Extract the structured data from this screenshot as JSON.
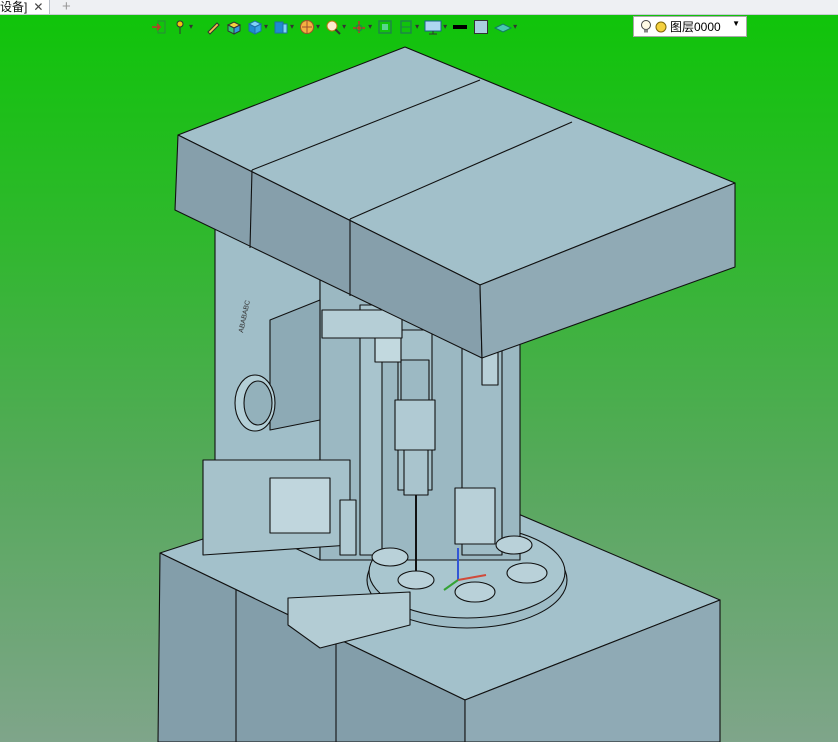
{
  "tabs": [
    {
      "label": "设备]",
      "close_icon": "close-icon"
    }
  ],
  "tab_add_label": "+",
  "toolbar": {
    "buttons": [
      {
        "name": "exit-sketch",
        "icon": "exit-arrow-icon"
      },
      {
        "name": "pin-light",
        "icon": "light-pin-icon",
        "dropdown": true
      },
      {
        "name": "pencil",
        "icon": "pencil-icon"
      },
      {
        "name": "render-solid",
        "icon": "solid-render-icon"
      },
      {
        "name": "view-cube",
        "icon": "cube-view-icon",
        "dropdown": true
      },
      {
        "name": "section-view",
        "icon": "section-cube-icon",
        "dropdown": true
      },
      {
        "name": "display-style",
        "icon": "sphere-shade-icon",
        "dropdown": true
      },
      {
        "name": "zoom",
        "icon": "zoom-lens-icon",
        "dropdown": true
      },
      {
        "name": "orient",
        "icon": "orient-axis-icon",
        "dropdown": true
      },
      {
        "name": "fit-view",
        "icon": "fit-frame-icon"
      },
      {
        "name": "layout",
        "icon": "frame-layout-icon",
        "dropdown": true
      },
      {
        "name": "screen-display",
        "icon": "monitor-icon",
        "dropdown": true
      },
      {
        "name": "line-color",
        "icon": "line-color-icon"
      },
      {
        "name": "fill-color",
        "icon": "fill-color-icon"
      },
      {
        "name": "layer-tool",
        "icon": "layer-plane-icon",
        "dropdown": true
      }
    ]
  },
  "layer": {
    "bulb_icon": "lightbulb-icon",
    "status_icon": "layer-dot-icon",
    "value": "图层0000",
    "dropdown_icon": "dropdown-arrow-icon"
  },
  "colors": {
    "viewport_top": "#10c40a",
    "viewport_bottom": "#7fa58a",
    "model_face_top": "#a2c0ca",
    "model_face_side": "#7f9aa6",
    "model_face_front": "#8ea9b4",
    "model_edge": "#111111"
  },
  "model": {
    "label": "ABABABC"
  }
}
